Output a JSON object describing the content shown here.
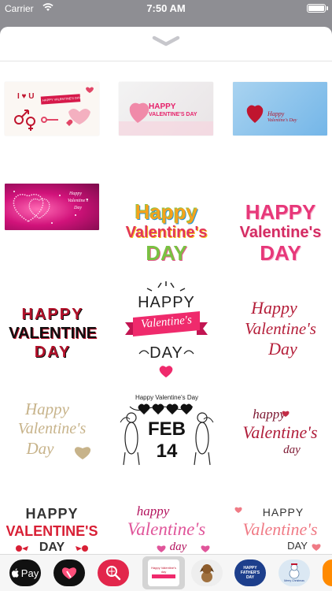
{
  "status_bar": {
    "carrier": "Carrier",
    "time": "7:50 AM"
  },
  "stickers": {
    "s1": {
      "top_text": "I ♥ U",
      "ribbon": "HAPPY VALENTINE'S DAY"
    },
    "s2": {
      "line1": "HAPPY",
      "line2": "VALENTINE'S DAY"
    },
    "s3": {
      "line1": "Happy",
      "line2": "Valentine's Day"
    },
    "s4": {
      "line1": "Happy",
      "line2": "Valentine's",
      "line3": "Day"
    },
    "s5": {
      "line1": "Happy",
      "line2": "Valentine's",
      "line3": "DAY"
    },
    "s6": {
      "line1": "HAPPY",
      "line2": "Valentine's",
      "line3": "DAY"
    },
    "s7": {
      "line1": "HAPPY",
      "line2": "VALENTINE",
      "line3": "DAY"
    },
    "s8": {
      "line1": "HAPPY",
      "line2": "Valentine's",
      "line3": "DAY"
    },
    "s9": {
      "line1": "Happy",
      "line2": "Valentine's",
      "line3": "Day"
    },
    "s10": {
      "line1": "Happy",
      "line2": "Valentine's",
      "line3": "Day"
    },
    "s11": {
      "line1": "Happy Valentine's Day",
      "line2": "FEB",
      "line3": "14"
    },
    "s12": {
      "line1": "happy",
      "line2": "Valentine's",
      "line3": "day"
    },
    "s13": {
      "line1": "HAPPY",
      "line2": "VALENTINE'S",
      "line3": "DAY"
    },
    "s14": {
      "line1": "happy",
      "line2": "Valentine's",
      "line3": "day"
    },
    "s15": {
      "line1": "HAPPY",
      "line2": "Valentine's",
      "line3": "DAY"
    }
  },
  "tray": {
    "apple_pay_label": "Pay",
    "thumb_valentine": "Happy Valentine's day",
    "thumb_fathers": "HAPPY FATHER'S DAY",
    "thumb_christmas": "Merry Christmas"
  },
  "colors": {
    "pink": "#e91e63",
    "red": "#c0152f",
    "gold": "#c7b38a",
    "dark": "#222222",
    "tray_bg": "#f6f6f6",
    "status_bg": "#8e8e93"
  }
}
